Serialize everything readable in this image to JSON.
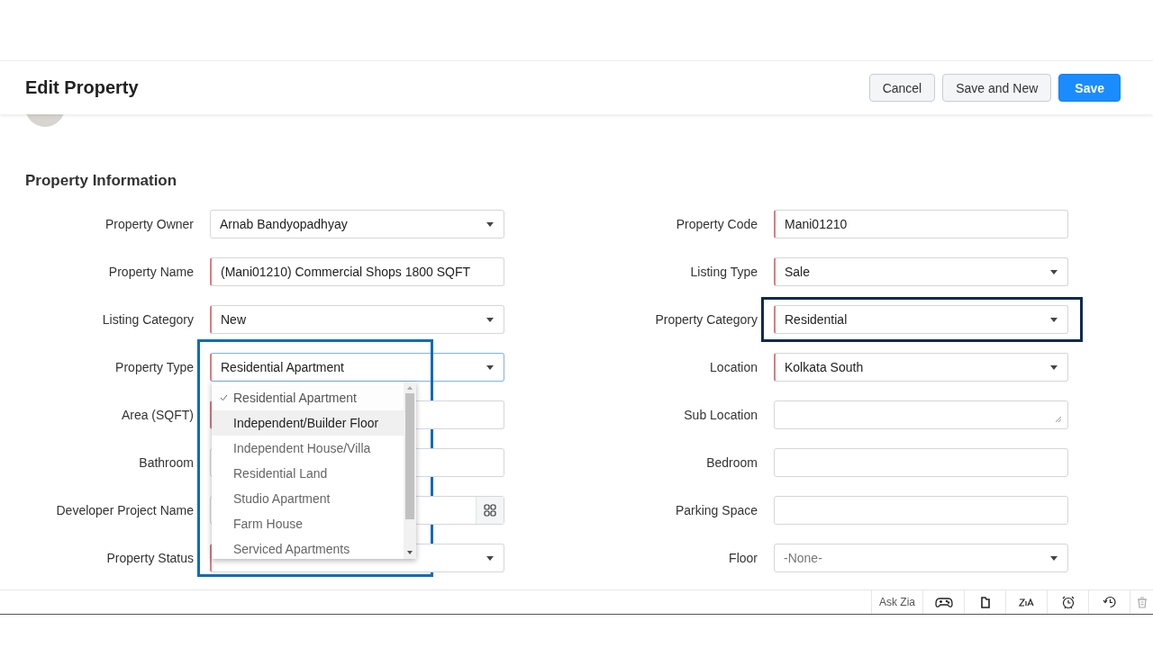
{
  "page": {
    "title": "Edit Property"
  },
  "header_buttons": [
    {
      "label": "Cancel",
      "kind": "secondary"
    },
    {
      "label": "Save and New",
      "kind": "secondary"
    },
    {
      "label": "Save",
      "kind": "primary"
    }
  ],
  "section": {
    "title": "Property Information"
  },
  "fields_left": [
    {
      "label": "Property Owner",
      "kind": "select",
      "value": "Arnab Bandyopadhyay",
      "required": false,
      "focused": false
    },
    {
      "label": "Property Name",
      "kind": "text",
      "value": "(Mani01210) Commercial Shops 1800 SQFT",
      "required": true,
      "focused": false
    },
    {
      "label": "Listing Category",
      "kind": "select",
      "value": "New",
      "required": true,
      "focused": false
    },
    {
      "label": "Property Type",
      "kind": "select",
      "value": "Residential Apartment",
      "required": true,
      "focused": true,
      "annotated": true,
      "options": [
        {
          "label": "Residential Apartment",
          "selected": true,
          "highlighted": false
        },
        {
          "label": "Independent/Builder Floor",
          "selected": false,
          "highlighted": true
        },
        {
          "label": "Independent House/Villa",
          "selected": false,
          "highlighted": false
        },
        {
          "label": "Residential Land",
          "selected": false,
          "highlighted": false
        },
        {
          "label": "Studio Apartment",
          "selected": false,
          "highlighted": false
        },
        {
          "label": "Farm House",
          "selected": false,
          "highlighted": false
        },
        {
          "label": "Serviced Apartments",
          "selected": false,
          "highlighted": false
        }
      ]
    },
    {
      "label": "Area (SQFT)",
      "kind": "text",
      "required": true,
      "focused": false
    },
    {
      "label": "Bathroom",
      "kind": "text",
      "required": false,
      "focused": false
    },
    {
      "label": "Developer Project Name",
      "kind": "lookup",
      "required": false,
      "focused": false
    },
    {
      "label": "Property Status",
      "kind": "select",
      "required": true,
      "focused": false
    }
  ],
  "fields_right": [
    {
      "label": "Property Code",
      "kind": "text",
      "value": "Mani01210",
      "required": true,
      "focused": false
    },
    {
      "label": "Listing Type",
      "kind": "select",
      "value": "Sale",
      "required": true,
      "focused": false
    },
    {
      "label": "Property Category",
      "kind": "select",
      "value": "Residential",
      "required": true,
      "focused": false,
      "annotated": true
    },
    {
      "label": "Location",
      "kind": "select",
      "value": "Kolkata South",
      "required": true,
      "focused": false
    },
    {
      "label": "Sub Location",
      "kind": "textarea",
      "required": false,
      "focused": false
    },
    {
      "label": "Bedroom",
      "kind": "text",
      "required": false,
      "focused": false
    },
    {
      "label": "Parking Space",
      "kind": "text",
      "required": false,
      "focused": false
    },
    {
      "label": "Floor",
      "kind": "select",
      "placeholder": "-None-",
      "required": false,
      "focused": false
    }
  ],
  "toolbar": {
    "ask_label": "Ask Zia"
  }
}
